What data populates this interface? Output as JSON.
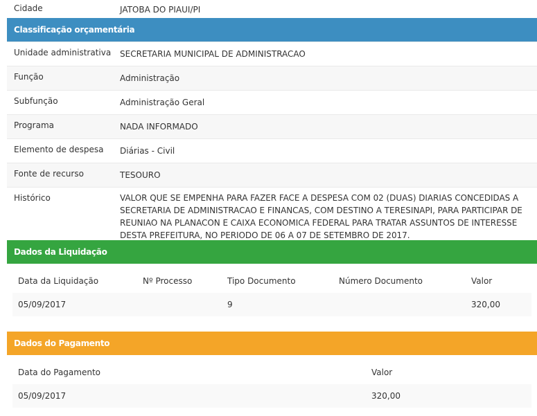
{
  "details": {
    "cidade": {
      "label": "Cidade",
      "value": "JATOBA DO PIAUI/PI"
    }
  },
  "classificacao": {
    "title": "Classificação orçamentária",
    "rows": [
      {
        "label": "Unidade administrativa",
        "value": "SECRETARIA MUNICIPAL DE ADMINISTRACAO"
      },
      {
        "label": "Função",
        "value": "Administração"
      },
      {
        "label": "Subfunção",
        "value": "Administração Geral"
      },
      {
        "label": "Programa",
        "value": "NADA INFORMADO"
      },
      {
        "label": "Elemento de despesa",
        "value": "Diárias - Civil"
      },
      {
        "label": "Fonte de recurso",
        "value": "TESOURO"
      }
    ],
    "historico": {
      "label": "Histórico",
      "value": "VALOR QUE SE EMPENHA PARA FAZER FACE A DESPESA COM 02 (DUAS) DIARIAS CONCEDIDAS A SECRETARIA DE ADMINISTRACAO E FINANCAS, COM DESTINO A TERESINAPI, PARA PARTICIPAR DE REUNIAO NA PLANACON E CAIXA ECONOMICA FEDERAL PARA TRATAR ASSUNTOS DE INTERESSE DESTA PREFEITURA, NO PERIODO DE 06 A 07 DE SETEMBRO DE 2017."
    }
  },
  "liquidacao": {
    "title": "Dados da Liquidação",
    "headers": [
      "Data da Liquidação",
      "Nº Processo",
      "Tipo Documento",
      "Número Documento",
      "Valor"
    ],
    "rows": [
      [
        "05/09/2017",
        "",
        "9",
        "",
        "320,00"
      ]
    ]
  },
  "pagamento": {
    "title": "Dados do Pagamento",
    "headers": [
      "Data do Pagamento",
      "Valor"
    ],
    "rows": [
      [
        "05/09/2017",
        "320,00"
      ]
    ]
  },
  "colors": {
    "blue": "#3d8ec1",
    "green": "#35a540",
    "orange": "#f4a528"
  }
}
